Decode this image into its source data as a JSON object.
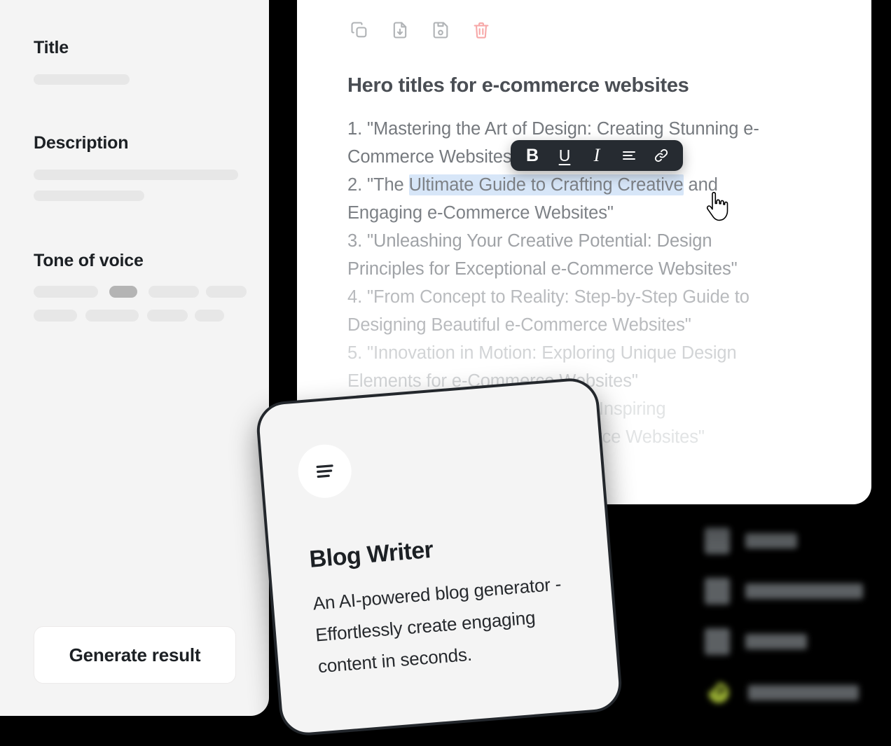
{
  "background_color": "#000000",
  "form_panel": {
    "background": "#f4f4f4",
    "fields": [
      {
        "label": "Title"
      },
      {
        "label": "Description"
      },
      {
        "label": "Tone of voice"
      }
    ],
    "title_label": "Title",
    "description_label": "Description",
    "tone_label": "Tone of voice",
    "generate_button": "Generate result"
  },
  "editor": {
    "background": "#ffffff",
    "toolbar": [
      {
        "name": "copy-icon",
        "label": "Copy",
        "color": "#b0b3b6"
      },
      {
        "name": "download-icon",
        "label": "Download",
        "color": "#b0b3b6"
      },
      {
        "name": "save-icon",
        "label": "Save",
        "color": "#b0b3b6"
      },
      {
        "name": "delete-icon",
        "label": "Delete",
        "color": "#f7a8a8"
      }
    ],
    "document_title": "Hero titles for e-commerce websites",
    "lines": [
      "1. \"Mastering the Art of Design: Creating Stunning e-",
      "Commerce Websites\"",
      "3. \"Unleashing Your Creative Potential: Design",
      "Principles for Exceptional e-Commerce Websites\"",
      "4. \"From Concept to Reality: Step-by-Step Guide to",
      "Designing Beautiful e-Commerce Websites\"",
      "5. \"Innovation in Motion: Exploring Unique Design",
      "Elements for e-Commerce Websites\"",
      "rytelling: Inspiring",
      "-Commerce Websites\""
    ],
    "line1a": "1. \"Mastering the Art of Design: Creating Stunning e-",
    "line1b": "Commerce Websites\"",
    "line2_prefix": "2. \"The ",
    "line2_selected": "Ultimate Guide to Crafting Creative",
    "line2_suffix": " and",
    "line2b": "Engaging e-Commerce Websites\"",
    "line3a": "3. \"Unleashing Your Creative Potential: Design",
    "line3b": "Principles for Exceptional e-Commerce Websites\"",
    "line4a": "4. \"From Concept to Reality: Step-by-Step Guide to",
    "line4b": "Designing Beautiful e-Commerce Websites\"",
    "line5a": "5. \"Innovation in Motion: Exploring Unique Design",
    "line5b": "Elements for e-Commerce Websites\"",
    "line6a": "rytelling: Inspiring",
    "line6b": "-Commerce Websites\"",
    "selection_color": "#d7e6f8"
  },
  "format_bar": {
    "background": "#262b31",
    "buttons": [
      {
        "name": "bold-button",
        "label": "B"
      },
      {
        "name": "underline-button",
        "label": "U"
      },
      {
        "name": "italic-button",
        "label": "I"
      },
      {
        "name": "align-button",
        "label": "align-left-icon"
      },
      {
        "name": "link-button",
        "label": "link-icon"
      }
    ],
    "bold": "B",
    "underline": "U",
    "italic": "I"
  },
  "blog_card": {
    "background": "#f4f4f4",
    "border_color": "#23272c",
    "icon": "text-lines-icon",
    "title": "Blog Writer",
    "description": "An AI-powered blog generator - Effortlessly create engaging content in seconds."
  },
  "blurred_menu": {
    "accent_color": "#c8e543",
    "items": [
      {
        "icon": "document-icon",
        "label": ""
      },
      {
        "icon": "document-icon",
        "label": ""
      },
      {
        "icon": "document-icon",
        "label": ""
      },
      {
        "icon": "spiral-logo-icon",
        "label": ""
      }
    ]
  },
  "cursor": {
    "type": "pointing-hand"
  }
}
